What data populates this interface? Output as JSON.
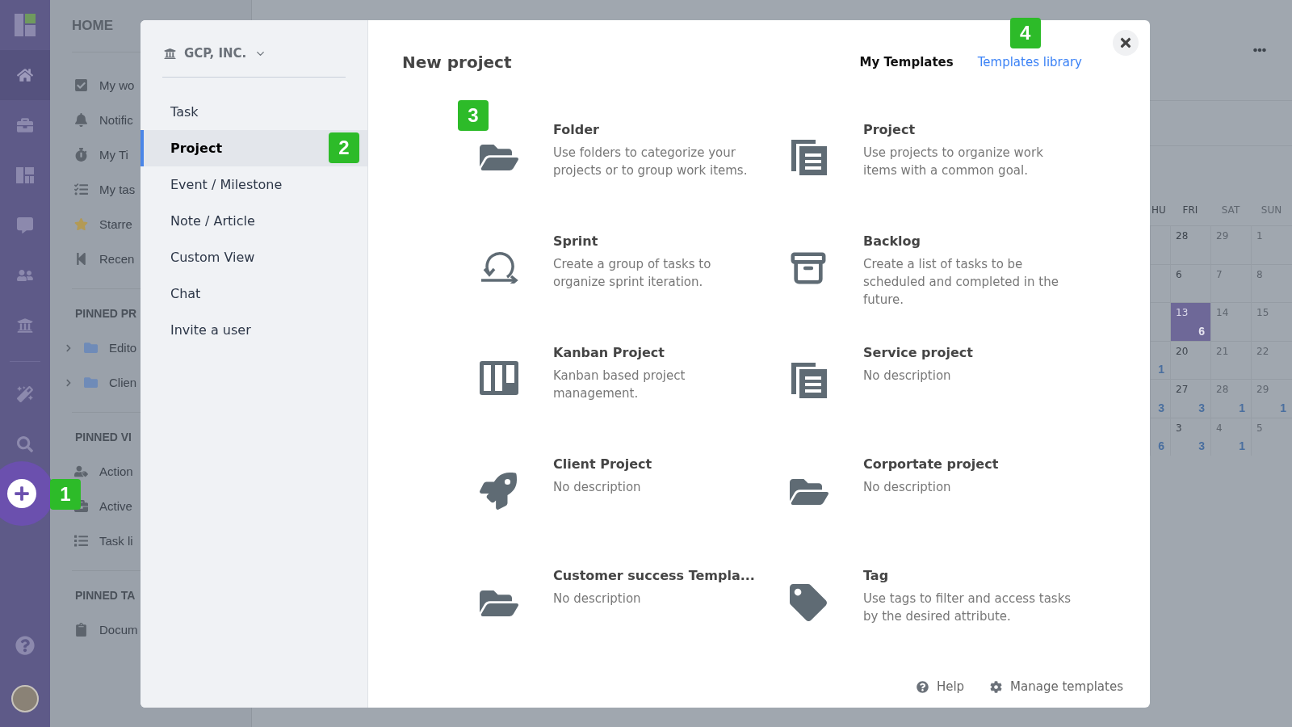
{
  "rail": {
    "items": [
      {
        "selected": true
      },
      {
        "selected": false
      },
      {
        "selected": false
      },
      {
        "selected": false
      },
      {
        "selected": false
      },
      {
        "selected": false
      }
    ],
    "tools": [
      {
        "selected": false
      },
      {
        "selected": false
      }
    ],
    "fab": {
      "callout": "1"
    }
  },
  "sidebar": {
    "title": "HOME",
    "items": [
      {
        "label": "My wo"
      },
      {
        "label": "Notific"
      },
      {
        "label": "My Ti"
      },
      {
        "label": "My tas"
      },
      {
        "label": "Starre"
      },
      {
        "label": "Recen"
      }
    ],
    "sections": [
      {
        "title": "PINNED PR",
        "items": [
          {
            "label": "Edito",
            "expanded": false
          },
          {
            "label": "Clien",
            "expanded": false
          }
        ]
      },
      {
        "title": "PINNED VI",
        "items": [
          {
            "label": "Action"
          },
          {
            "label": "Active"
          },
          {
            "label": "Task li"
          }
        ]
      },
      {
        "title": "PINNED TA",
        "items": [
          {
            "label": "Docum"
          }
        ]
      }
    ]
  },
  "calendar": {
    "columns": [
      {
        "label": "HU",
        "weekend": false
      },
      {
        "label": "FRI",
        "weekend": false
      },
      {
        "label": "SAT",
        "weekend": true
      },
      {
        "label": "SUN",
        "weekend": true
      }
    ],
    "weeks": [
      [
        {
          "selected": false
        },
        {
          "day": "28",
          "selected": false
        },
        {
          "day": "29",
          "selected": false
        },
        {
          "day": "1",
          "selected": false
        }
      ],
      [
        {
          "selected": false
        },
        {
          "day": "6",
          "selected": false
        },
        {
          "day": "7",
          "selected": false
        },
        {
          "day": "8",
          "selected": false
        }
      ],
      [
        {
          "selected": false
        },
        {
          "day": "13",
          "count": "6",
          "selected": true
        },
        {
          "day": "14",
          "selected": false
        },
        {
          "day": "15",
          "selected": false
        }
      ],
      [
        {
          "count": "1",
          "selected": false
        },
        {
          "day": "20",
          "selected": false
        },
        {
          "day": "21",
          "selected": false
        },
        {
          "day": "22",
          "selected": false
        }
      ],
      [
        {
          "count": "3",
          "selected": false
        },
        {
          "day": "27",
          "count": "3",
          "selected": false
        },
        {
          "day": "28",
          "count": "1",
          "selected": false
        },
        {
          "day": "29",
          "count": "1",
          "selected": false
        }
      ],
      [
        {
          "count": "6",
          "selected": false
        },
        {
          "day": "3",
          "count": "3",
          "selected": false
        },
        {
          "day": "4",
          "count": "1",
          "selected": false
        },
        {
          "day": "5",
          "selected": false
        }
      ]
    ]
  },
  "modal": {
    "workspace": "GCP, INC.",
    "menu": [
      {
        "label": "Task",
        "selected": false
      },
      {
        "label": "Project",
        "selected": true,
        "callout": "2"
      },
      {
        "label": "Event / Milestone",
        "selected": false
      },
      {
        "label": "Note / Article",
        "selected": false
      },
      {
        "label": "Custom View",
        "selected": false
      },
      {
        "label": "Chat",
        "selected": false
      },
      {
        "label": "Invite a user",
        "selected": false
      }
    ],
    "title": "New project",
    "tabs": [
      {
        "label": "My Templates",
        "selected": true
      },
      {
        "label": "Templates library",
        "selected": false,
        "callout": "4"
      }
    ],
    "templates": [
      {
        "kind": "folder",
        "title": "Folder",
        "description": "Use folders to categorize your projects or to group work items.",
        "callout": "3"
      },
      {
        "kind": "documents",
        "title": "Project",
        "description": "Use projects to organize work items with a common goal."
      },
      {
        "kind": "sprint",
        "title": "Sprint",
        "description": "Create a group of tasks to organize sprint iteration."
      },
      {
        "kind": "archive",
        "title": "Backlog",
        "description": "Create a list of tasks to be scheduled and completed in the future."
      },
      {
        "kind": "kanban",
        "title": "Kanban Project",
        "description": "Kanban based project management."
      },
      {
        "kind": "documents",
        "title": "Service project",
        "description": "No description"
      },
      {
        "kind": "rocket",
        "title": "Client Project",
        "description": "No description"
      },
      {
        "kind": "folder",
        "title": "Corportate project",
        "description": "No description"
      },
      {
        "kind": "folder",
        "title": "Customer success Templa...",
        "description": "No description"
      },
      {
        "kind": "tag",
        "title": "Tag",
        "description": "Use tags to filter and access tasks by the desired attribute."
      }
    ],
    "footer": {
      "help": "Help",
      "manage": "Manage templates"
    }
  }
}
